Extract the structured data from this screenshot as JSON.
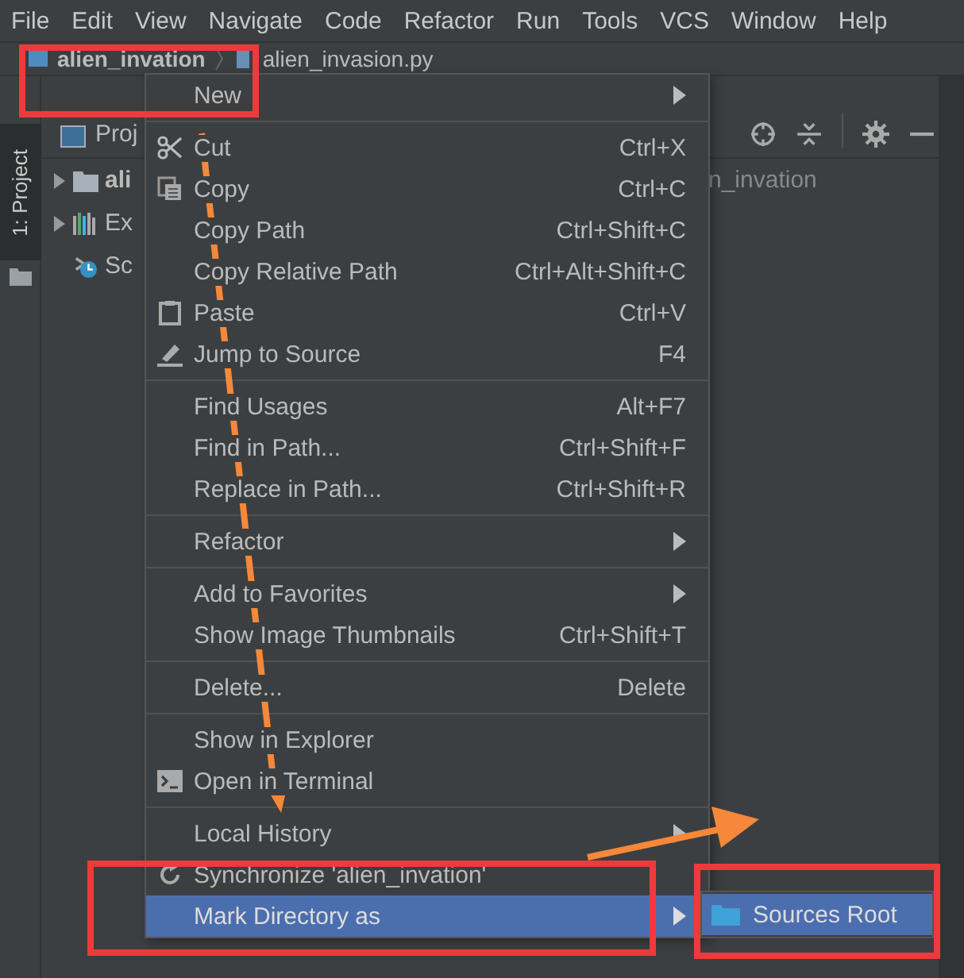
{
  "menubar": [
    "File",
    "Edit",
    "View",
    "Navigate",
    "Code",
    "Refactor",
    "Run",
    "Tools",
    "VCS",
    "Window",
    "Help"
  ],
  "breadcrumbs": [
    {
      "label": "alien_invation",
      "kind": "folder"
    },
    {
      "label": "alien_invasion.py",
      "kind": "file"
    }
  ],
  "tool_window_tab": {
    "label": "1: Project",
    "selected": true
  },
  "project_panel": {
    "view_label": "Proj",
    "tree": [
      {
        "label": "ali",
        "path": "n_invation",
        "expanded": false
      },
      {
        "label": "Ex",
        "expanded": false
      },
      {
        "label": "Sc"
      }
    ]
  },
  "context_menu": {
    "items": [
      {
        "kind": "item",
        "label": "New",
        "submenu": true,
        "selected": false
      },
      {
        "kind": "separator"
      },
      {
        "kind": "item",
        "label": "Cut",
        "shortcut": "Ctrl+X",
        "selected": false
      },
      {
        "kind": "item",
        "label": "Copy",
        "shortcut": "Ctrl+C",
        "selected": false
      },
      {
        "kind": "item",
        "label": "Copy Path",
        "shortcut": "Ctrl+Shift+C",
        "selected": false
      },
      {
        "kind": "item",
        "label": "Copy Relative Path",
        "shortcut": "Ctrl+Alt+Shift+C",
        "selected": false
      },
      {
        "kind": "item",
        "label": "Paste",
        "shortcut": "Ctrl+V",
        "selected": false
      },
      {
        "kind": "item",
        "label": "Jump to Source",
        "shortcut": "F4",
        "selected": false
      },
      {
        "kind": "separator"
      },
      {
        "kind": "item",
        "label": "Find Usages",
        "shortcut": "Alt+F7",
        "selected": false
      },
      {
        "kind": "item",
        "label": "Find in Path...",
        "shortcut": "Ctrl+Shift+F",
        "selected": false
      },
      {
        "kind": "item",
        "label": "Replace in Path...",
        "shortcut": "Ctrl+Shift+R",
        "selected": false
      },
      {
        "kind": "separator"
      },
      {
        "kind": "item",
        "label": "Refactor",
        "submenu": true,
        "selected": false
      },
      {
        "kind": "separator"
      },
      {
        "kind": "item",
        "label": "Add to Favorites",
        "submenu": true,
        "selected": false
      },
      {
        "kind": "item",
        "label": "Show Image Thumbnails",
        "shortcut": "Ctrl+Shift+T",
        "selected": false
      },
      {
        "kind": "separator"
      },
      {
        "kind": "item",
        "label": "Delete...",
        "shortcut": "Delete",
        "selected": false
      },
      {
        "kind": "separator"
      },
      {
        "kind": "item",
        "label": "Show in Explorer",
        "selected": false
      },
      {
        "kind": "item",
        "label": "Open in Terminal",
        "selected": false
      },
      {
        "kind": "separator"
      },
      {
        "kind": "item",
        "label": "Local History",
        "submenu": true,
        "selected": false
      },
      {
        "kind": "item",
        "label": "Synchronize 'alien_invation'",
        "selected": false
      },
      {
        "kind": "item",
        "label": "Mark Directory as",
        "submenu": true,
        "selected": true
      }
    ]
  },
  "submenu": {
    "items": [
      {
        "label": "Sources Root",
        "selected": true
      }
    ]
  }
}
